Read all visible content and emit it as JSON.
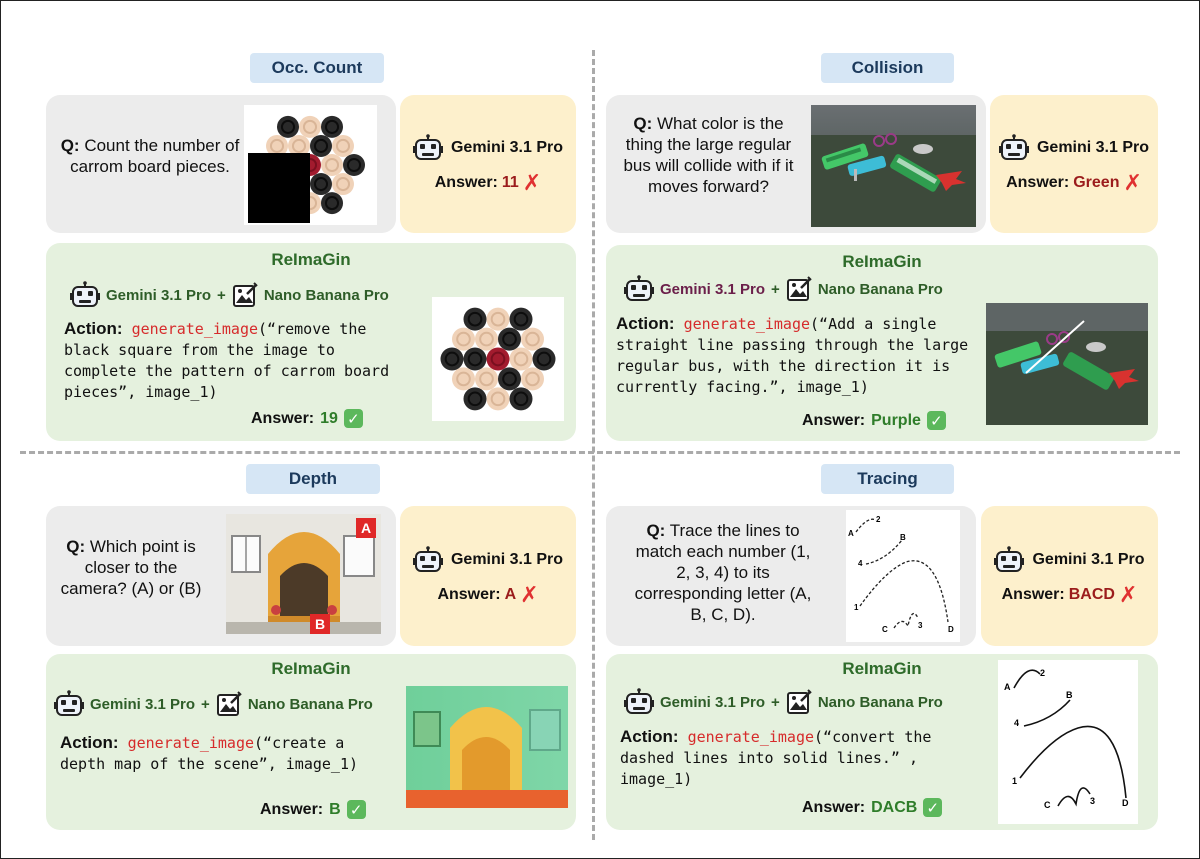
{
  "model_name": "Gemini 3.1 Pro",
  "reimagin_title": "ReImaGin",
  "tool_name": "Nano Banana Pro",
  "plus": "+",
  "answer_label": "Answer:",
  "action_label": "Action:",
  "q_label": "Q:",
  "fn_name": "generate_image",
  "icons": {
    "robot": "robot-icon",
    "image_edit": "image-edit-icon",
    "wrong": "cross-mark-icon",
    "right": "check-mark-icon"
  },
  "colors": {
    "tag_bg": "#d6e6f5",
    "question_bg": "#ececec",
    "answer_bg": "#fdf0cc",
    "reimagin_bg": "#e5f1de",
    "wrong": "#9b1c1c",
    "right": "#2f7d2a",
    "fn": "#d62b2b"
  },
  "panels": [
    {
      "tag": "Occ. Count",
      "question": "Count the number of carrom board pieces.",
      "baseline_answer": "11",
      "action_args": "(“remove the black square from the image to complete the pattern of carrom board pieces”, image_1)",
      "final_answer": "19"
    },
    {
      "tag": "Collision",
      "question": "What color is the thing the large regular bus will collide with if it moves forward?",
      "baseline_answer": "Green",
      "action_args": "(“Add a single straight line passing through the large regular bus, with the direction it is currently facing.”, image_1)",
      "final_answer": "Purple"
    },
    {
      "tag": "Depth",
      "question": "Which point is closer to the camera? (A) or (B)",
      "point_labels": [
        "A",
        "B"
      ],
      "baseline_answer": "A",
      "action_args": "(“create a depth map of the scene”, image_1)",
      "final_answer": "B"
    },
    {
      "tag": "Tracing",
      "question": "Trace the lines to match each number (1, 2, 3, 4) to its corresponding letter (A, B, C, D).",
      "trace_labels": [
        "A",
        "2",
        "B",
        "4",
        "1",
        "C",
        "3",
        "D"
      ],
      "baseline_answer": "BACD",
      "action_args": "(“convert the dashed lines into solid lines.” , image_1)",
      "final_answer": "DACB"
    }
  ]
}
